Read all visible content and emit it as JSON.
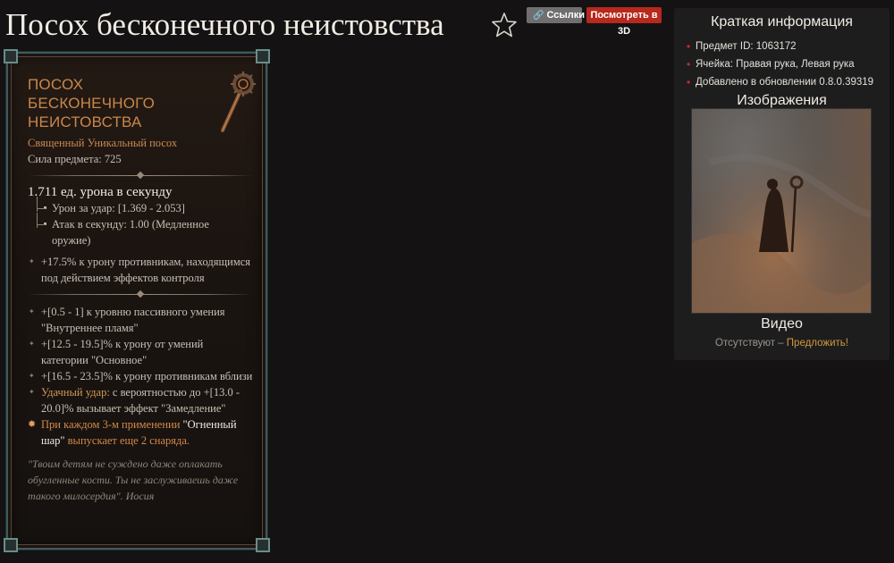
{
  "page": {
    "title": "Посох бесконечного неистовства"
  },
  "toolbar": {
    "links_label": "Ссылки",
    "view3d_label": "Посмотреть в 3D"
  },
  "item": {
    "name_lines": [
      "ПОСОХ",
      "БЕСКОНЕЧНОГО",
      "НЕИСТОВСТВА"
    ],
    "type": "Священный Уникальный посох",
    "power": "Сила предмета: 725",
    "dps": "1.711 ед. урона в секунду",
    "damage_per_hit": "Урон за удар: [1.369 - 2.053]",
    "attacks_per_second_line1": "Атак в секунду: 1.00 (Медленное",
    "attacks_per_second_line2": "оружие)",
    "implicit": "+17.5% к урону противникам, находящимся под действием эффектов контроля",
    "affixes": [
      "+[0.5 - 1] к уровню пассивного умения \"Внутреннее пламя\"",
      "+[12.5 - 19.5]% к урону от умений категории \"Основное\"",
      "+[16.5 - 23.5]% к урону противникам вблизи"
    ],
    "lucky_hit_prefix": "Удачный удар:",
    "lucky_hit_text": " с вероятностью до +[13.0 - 20.0]% вызывает эффект \"Замедление\"",
    "aspect_part1": "При каждом 3-м применении ",
    "aspect_skill": "\"Огненный шар\"",
    "aspect_part2": " выпускает еще 2 снаряда.",
    "flavor": "\"Твоим детям не суждено даже оплакать обугленные кости. Ты не заслуживаешь даже такого милосердия\". Иосия"
  },
  "panel": {
    "title": "Краткая информация",
    "info": [
      "Предмет ID: 1063172",
      "Ячейка: Правая рука, Левая рука",
      "Добавлено в обновлении 0.8.0.39319"
    ],
    "images_title": "Изображения",
    "video_title": "Видео",
    "video_missing": "Отсутствуют – ",
    "video_suggest": "Предложить!"
  },
  "colors": {
    "background": "#141212",
    "unique_orange": "#c9874a",
    "lucky_hit_gold": "#d09a57",
    "button_red": "#b7281d",
    "button_gray": "#6f6f6f",
    "frame_teal": "#3e5b5c",
    "link_gold": "#d09a40"
  },
  "icons": {
    "favorite": "star-outline-icon",
    "links": "link-icon",
    "item": "fire-staff-icon"
  }
}
